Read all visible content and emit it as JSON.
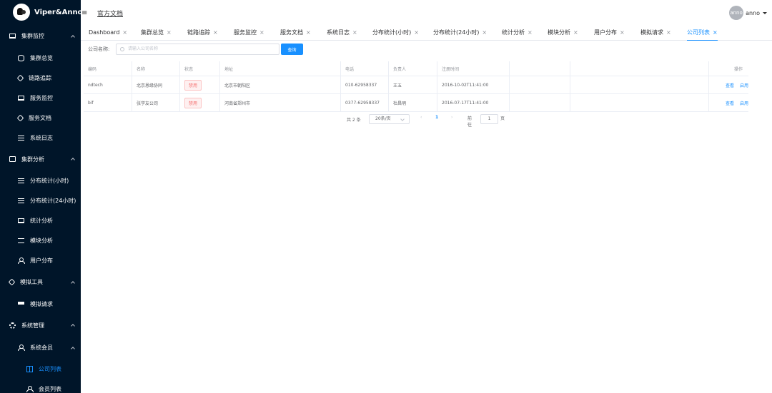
{
  "app": {
    "logo_text": "Viper&Anno"
  },
  "header": {
    "doc_link": "官方文档",
    "avatar_text": "anno",
    "user_name": "anno"
  },
  "sidebar": {
    "groups": [
      {
        "label": "集群监控",
        "items": [
          "集群总览",
          "链路追踪",
          "服务监控",
          "服务文档",
          "系统日志"
        ]
      },
      {
        "label": "集群分析",
        "items": [
          "分布统计(小时)",
          "分布统计(24小时)",
          "统计分析",
          "模块分析",
          "用户分布"
        ]
      },
      {
        "label": "模拟工具",
        "items": [
          "模拟请求"
        ]
      },
      {
        "label": "系统管理",
        "sub_label": "系统会员",
        "items": [
          "公司列表",
          "会员列表"
        ]
      }
    ]
  },
  "tabs": [
    "Dashboard",
    "集群总览",
    "链路追踪",
    "服务监控",
    "服务文档",
    "系统日志",
    "分布统计(小时)",
    "分布统计(24小时)",
    "统计分析",
    "模块分析",
    "用户分布",
    "模拟请求",
    "公司列表"
  ],
  "active_tab": "公司列表",
  "search": {
    "label": "公司名称:",
    "placeholder": "请输入公司名称",
    "button": "查询"
  },
  "table": {
    "headers": [
      "编码",
      "名称",
      "状态",
      "地址",
      "电话",
      "负责人",
      "注册时间",
      "",
      "",
      "操作"
    ],
    "rows": [
      {
        "code": "ndtech",
        "name": "北京恩缘协同",
        "status": "禁用",
        "address": "北京市朝阳区",
        "phone": "010-62958337",
        "owner": "王五",
        "reg_time": "2016-10-02T11:41:00",
        "op_view": "查看",
        "op_enable": "启用"
      },
      {
        "code": "bif",
        "name": "张学友公司",
        "status": "禁用",
        "address": "河南省郑州市",
        "phone": "0377-62958337",
        "owner": "杜昌明",
        "reg_time": "2016-07-17T11:41:00",
        "op_view": "查看",
        "op_enable": "启用"
      }
    ]
  },
  "pagination": {
    "total": "共 2 条",
    "page_size": "20条/页",
    "prev": "‹",
    "current": "1",
    "next": "›",
    "goto_label": "前往",
    "goto_value": "1",
    "unit": "页"
  },
  "colors": {
    "sidebar_bg": "#001529",
    "accent": "#1890ff",
    "danger": "#f56c6c"
  }
}
